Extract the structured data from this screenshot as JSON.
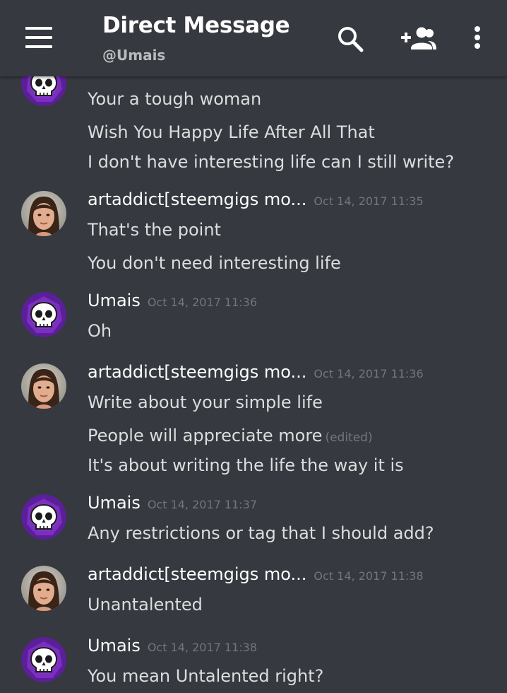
{
  "header": {
    "title": "Direct Message",
    "subtitle": "@Umais",
    "icons": [
      "menu-icon",
      "search-icon",
      "add-friend-icon",
      "more-vert-icon"
    ]
  },
  "colors": {
    "background": "#36393f",
    "text": "#dcddde",
    "timestamp": "#72767d",
    "skull_avatar_bg": "#7b2fbf"
  },
  "messages": [
    {
      "lines": [
        "Your a tough woman",
        "Wish You Happy Life After All That",
        "I don't have interesting life can I still write?"
      ]
    },
    {
      "author": "artaddict[steemgigs mo...",
      "time": "Oct 14, 2017 11:35",
      "lines": [
        "That's the point",
        "You don't need interesting life"
      ]
    },
    {
      "author": "Umais",
      "time": "Oct 14, 2017 11:36",
      "lines": [
        "Oh"
      ]
    },
    {
      "author": "artaddict[steemgigs mo...",
      "time": "Oct 14, 2017 11:36",
      "lines": [
        "Write about your simple life",
        "People will appreciate more",
        "It's about writing the life the way it is"
      ],
      "edited_label": "(edited)"
    },
    {
      "author": "Umais",
      "time": "Oct 14, 2017 11:37",
      "lines": [
        "Any restrictions or tag that I should add?"
      ]
    },
    {
      "author": "artaddict[steemgigs mo...",
      "time": "Oct 14, 2017 11:38",
      "lines": [
        "Unantalented"
      ]
    },
    {
      "author": "Umais",
      "time": "Oct 14, 2017 11:38",
      "lines": [
        "You mean Untalented right?"
      ]
    }
  ]
}
